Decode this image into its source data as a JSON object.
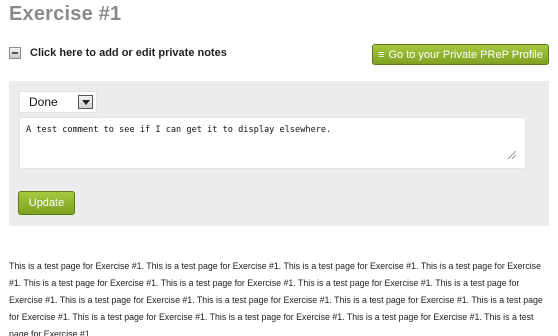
{
  "page": {
    "title": "Exercise #1",
    "body_text": "This is a test page for Exercise #1. This is a test page for Exercise #1. This is a test page for Exercise #1. This is a test page for Exercise #1. This is a test page for Exercise #1. This is a test page for Exercise #1. This is a test page for Exercise #1. This is a test page for Exercise #1. This is a test page for Exercise #1. This is a test page for Exercise #1. This is a test page for Exercise #1. This is a test page for Exercise #1. This is a test page for Exercise #1. This is a test page for Exercise #1. This is a test page for Exercise #1. This is a test page for Exercise #1."
  },
  "notes": {
    "toggle_label": "Click here to add or edit private notes",
    "status_selected": "Done",
    "comment_value": "A test comment to see if I can get it to display elsewhere.",
    "update_label": "Update"
  },
  "header": {
    "profile_button_label": "Go to your Private PReP Profile",
    "profile_button_icon": "list-icon"
  },
  "colors": {
    "accent_green": "#8db12c",
    "title_gray": "#8a8a8a",
    "panel_bg": "#ececec"
  }
}
